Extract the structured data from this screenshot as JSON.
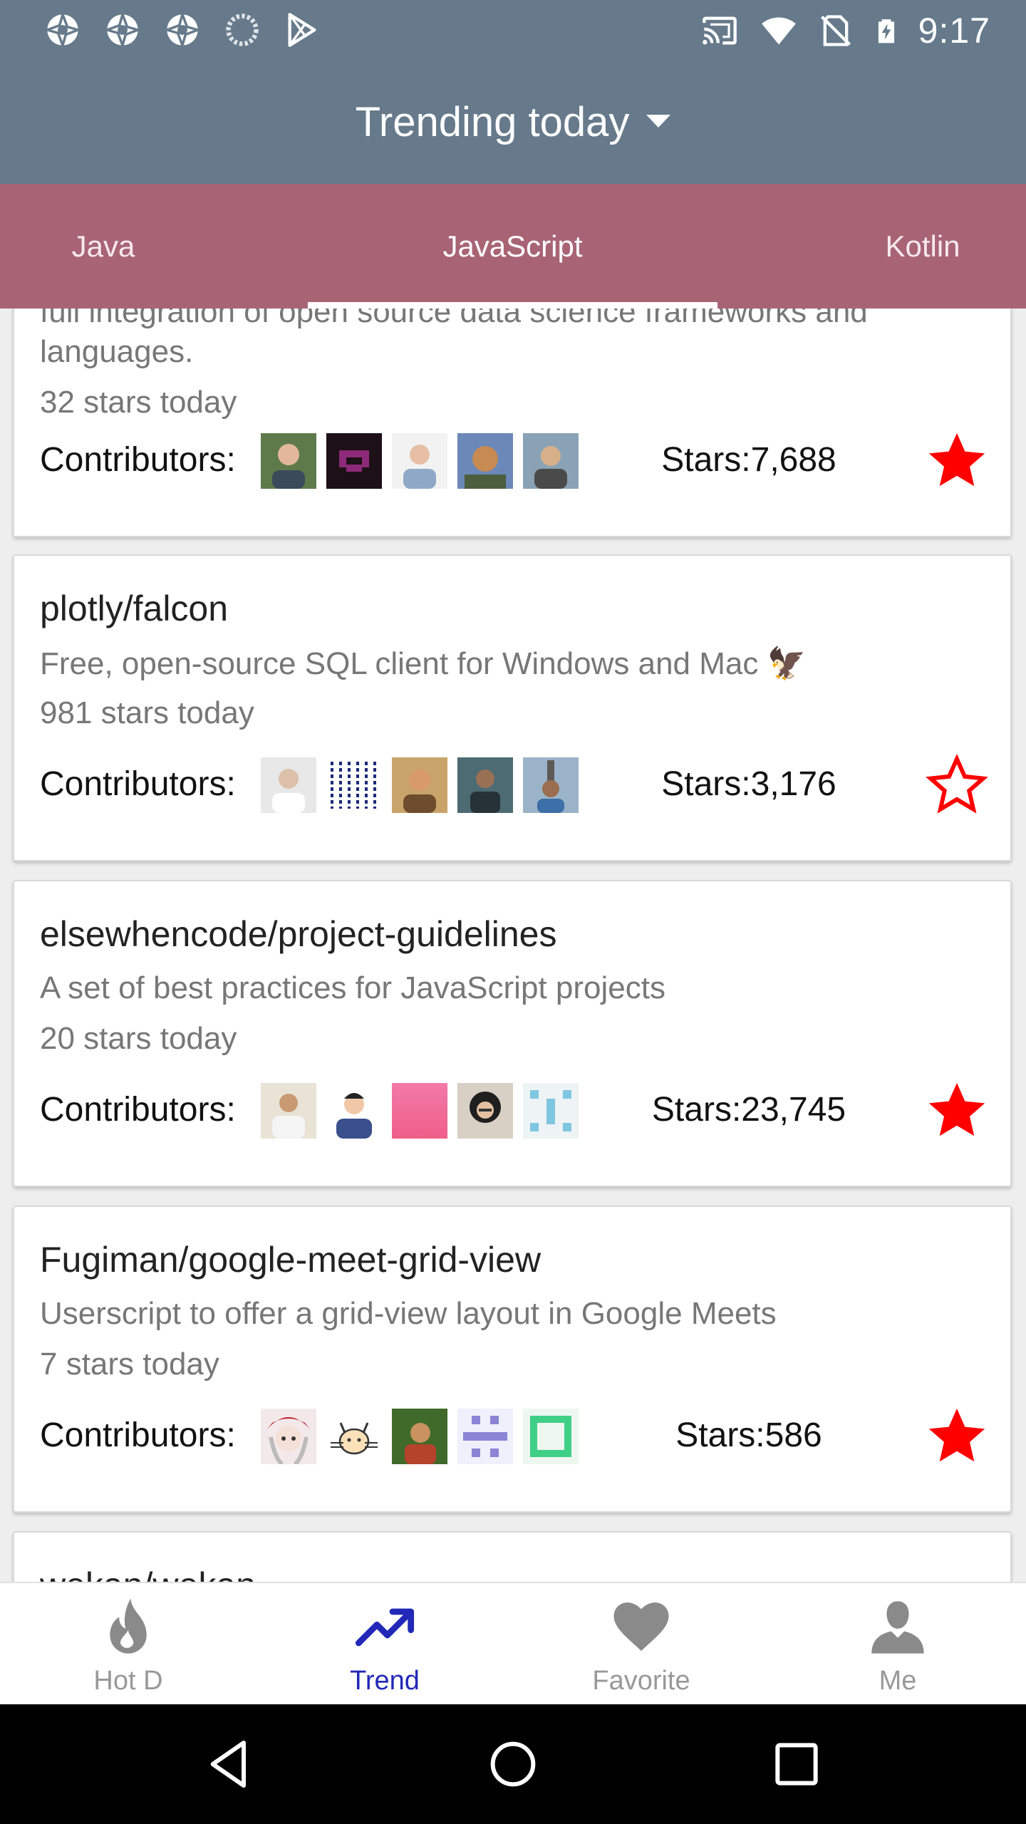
{
  "status_bar": {
    "time": "9:17",
    "left_icons": [
      "aperture-icon",
      "aperture-icon",
      "aperture-icon",
      "loading-spinner-icon",
      "play-store-icon"
    ],
    "right_icons": [
      "cast-icon",
      "wifi-icon",
      "no-sim-icon",
      "battery-charging-icon"
    ]
  },
  "app_bar": {
    "title": "Trending today"
  },
  "tabs": [
    {
      "label": "Java",
      "active": false
    },
    {
      "label": "JavaScript",
      "active": true
    },
    {
      "label": "Kotlin",
      "active": false
    }
  ],
  "repos": [
    {
      "name": "",
      "description_lines": [
        "full integration of open source data science frameworks and",
        "languages."
      ],
      "today": "32 stars today",
      "contributors_label": "Contributors:",
      "stars": "Stars:7,688",
      "starred": true
    },
    {
      "name": "plotly/falcon",
      "description_lines": [
        "Free, open-source SQL client for Windows and Mac 🦅"
      ],
      "today": "981 stars today",
      "contributors_label": "Contributors:",
      "stars": "Stars:3,176",
      "starred": false
    },
    {
      "name": "elsewhencode/project-guidelines",
      "description_lines": [
        "A set of best practices for JavaScript projects"
      ],
      "today": "20 stars today",
      "contributors_label": "Contributors:",
      "stars": "Stars:23,745",
      "starred": true
    },
    {
      "name": "Fugiman/google-meet-grid-view",
      "description_lines": [
        "Userscript to offer a grid-view layout in Google Meets"
      ],
      "today": "7 stars today",
      "contributors_label": "Contributors:",
      "stars": "Stars:586",
      "starred": true
    },
    {
      "name": "wekan/wekan",
      "description_lines": [],
      "today": "",
      "contributors_label": "",
      "stars": "",
      "starred": false
    }
  ],
  "bottom_nav": [
    {
      "label": "Hot D",
      "icon": "flame-icon",
      "active": false
    },
    {
      "label": "Trend",
      "icon": "trending-up-icon",
      "active": true
    },
    {
      "label": "Favorite",
      "icon": "heart-icon",
      "active": false
    },
    {
      "label": "Me",
      "icon": "person-icon",
      "active": false
    }
  ],
  "colors": {
    "status_bar": "#667a8b",
    "app_bar": "#667a8b",
    "tab_bar": "#a86475",
    "star": "#ff0000",
    "nav_active": "#2229b8",
    "nav_inactive": "#999999"
  }
}
